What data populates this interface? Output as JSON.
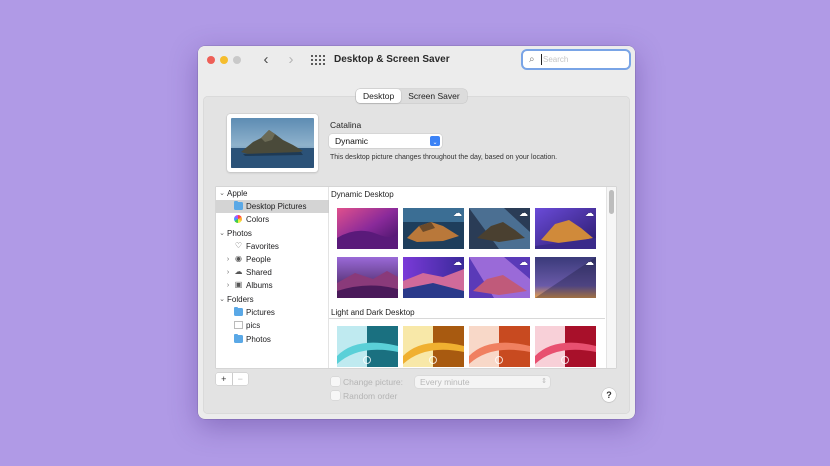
{
  "window": {
    "title": "Desktop & Screen Saver",
    "search_placeholder": "Search"
  },
  "tabs": [
    {
      "label": "Desktop",
      "active": true
    },
    {
      "label": "Screen Saver",
      "active": false
    }
  ],
  "current": {
    "name": "Catalina",
    "mode": "Dynamic",
    "description": "This desktop picture changes throughout the day, based on your location."
  },
  "sidebar": {
    "items": [
      {
        "label": "Apple",
        "type": "section",
        "icon": "chevron-down-icon"
      },
      {
        "label": "Desktop Pictures",
        "type": "child",
        "icon": "folder-icon",
        "selected": true
      },
      {
        "label": "Colors",
        "type": "child",
        "icon": "colors-icon"
      },
      {
        "label": "Photos",
        "type": "section",
        "icon": "chevron-down-icon"
      },
      {
        "label": "Favorites",
        "type": "child",
        "icon": "heart-icon"
      },
      {
        "label": "People",
        "type": "child-collapsed",
        "icon": "person-icon"
      },
      {
        "label": "Shared",
        "type": "child-collapsed",
        "icon": "cloud-icon"
      },
      {
        "label": "Albums",
        "type": "child-collapsed",
        "icon": "album-icon"
      },
      {
        "label": "Folders",
        "type": "section",
        "icon": "chevron-down-icon"
      },
      {
        "label": "Pictures",
        "type": "child",
        "icon": "folder-icon"
      },
      {
        "label": "pics",
        "type": "child",
        "icon": "document-icon"
      },
      {
        "label": "Photos",
        "type": "child",
        "icon": "folder-icon"
      }
    ],
    "add_label": "+",
    "remove_label": "−"
  },
  "gallery": {
    "sections": [
      {
        "title": "Dynamic Desktop"
      },
      {
        "title": "Light and Dark Desktop"
      }
    ]
  },
  "options": {
    "change_picture_label": "Change picture:",
    "interval_value": "Every minute",
    "random_order_label": "Random order"
  },
  "help_label": "?",
  "colors": {
    "background": "#b09ae6",
    "accent": "#3b82f6",
    "search_focus": "#79a4e6"
  }
}
